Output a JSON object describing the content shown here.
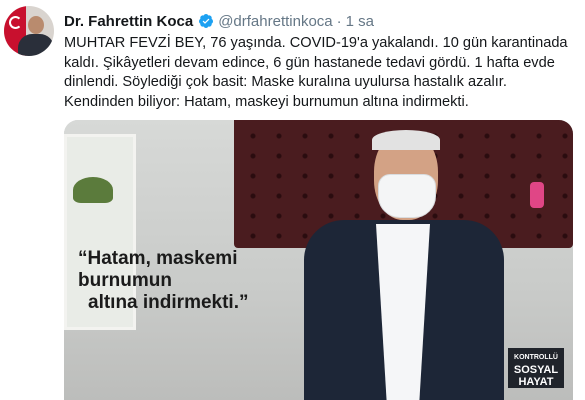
{
  "tweet": {
    "author_name": "Dr. Fahrettin Koca",
    "handle": "@drfahrettinkoca",
    "separator": "·",
    "time": "1 sa",
    "verified_icon": "verified-badge-icon",
    "accent_color": "#1da1f2",
    "text": "MUHTAR FEVZİ BEY, 76 yaşında. COVID-19'a yakalandı. 10 gün karantinada\nkaldı. Şikâyetleri devam edince, 6 gün hastanede tedavi gördü. 1 hafta evde\ndinlendi. Söylediği çok basit: Maske kuralına uyulursa hastalık azalır.\nKendinden biliyor: Hatam, maskeyi burnumun altına indirmekti."
  },
  "media": {
    "quote_line1": "“Hatam, maskemi burnumun",
    "quote_line2": "altına indirmekti.”",
    "badge_line1": "KONTROLLÜ",
    "badge_line2": "SOSYAL",
    "badge_line3": "HAYAT"
  }
}
